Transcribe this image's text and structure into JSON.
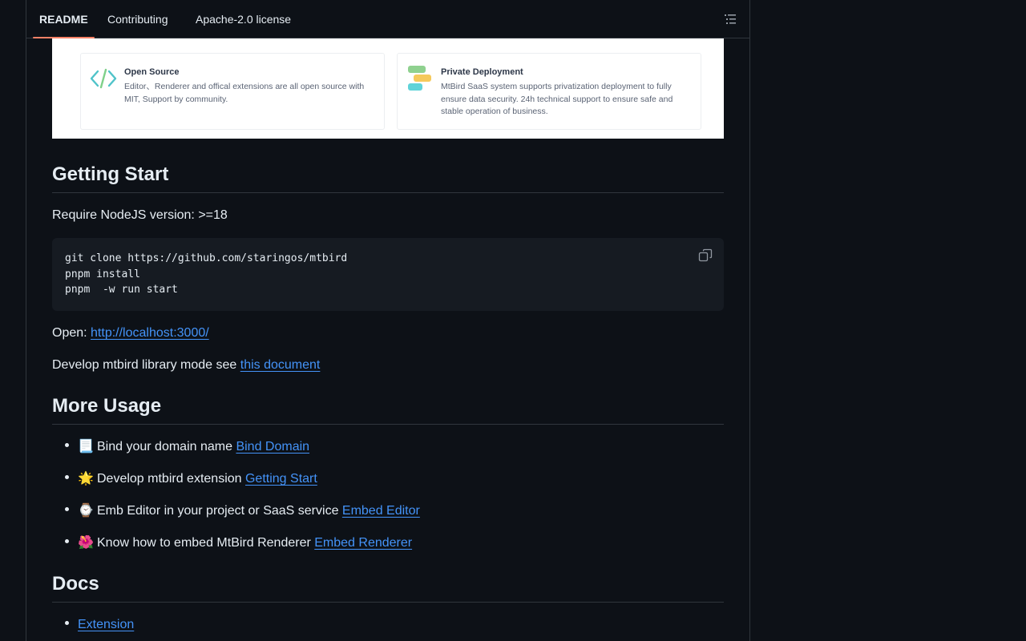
{
  "tabs": [
    {
      "label": "README",
      "active": true
    },
    {
      "label": "Contributing",
      "active": false
    },
    {
      "label": "Apache-2.0 license",
      "active": false
    }
  ],
  "banner": {
    "cards": [
      {
        "title": "Open Source",
        "text": "Editor、Renderer and offical extensions are all open source with MIT, Support by community.",
        "icon": "code-icon"
      },
      {
        "title": "Private Deployment",
        "text": "MtBird SaaS system supports privatization deployment to fully ensure data security. 24h technical support to ensure safe and stable operation of business.",
        "icon": "chat-bubbles-icon"
      }
    ]
  },
  "getting_start": {
    "heading": "Getting Start",
    "require": "Require NodeJS version: >=18",
    "code": "git clone https://github.com/staringos/mtbird\npnpm install\npnpm  -w run start",
    "open_label": "Open: ",
    "open_link": "http://localhost:3000/",
    "library_text": "Develop mtbird library mode see ",
    "library_link": "this document"
  },
  "more_usage": {
    "heading": "More Usage",
    "items": [
      {
        "emoji": "📃",
        "text": "Bind your domain name ",
        "link": "Bind Domain"
      },
      {
        "emoji": "🌟",
        "text": "Develop mtbird extension ",
        "link": "Getting Start"
      },
      {
        "emoji": "⌚",
        "text": "Emb Editor in your project or SaaS service ",
        "link": "Embed Editor"
      },
      {
        "emoji": "🌺",
        "text": "Know how to embed MtBird Renderer ",
        "link": "Embed Renderer"
      }
    ]
  },
  "docs": {
    "heading": "Docs",
    "items": [
      {
        "link": "Extension"
      }
    ]
  },
  "colors": {
    "background": "#0d1117",
    "link": "#4493f8",
    "active_tab_underline": "#f78166",
    "code_background": "#161b22"
  }
}
